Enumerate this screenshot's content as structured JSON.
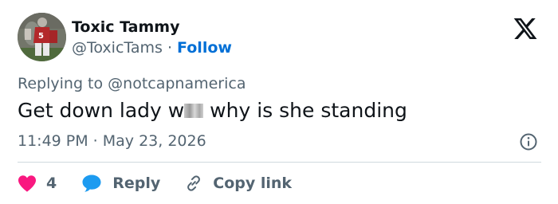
{
  "author": {
    "display_name": "Toxic Tammy",
    "handle": "@ToxicTams",
    "separator": "·",
    "follow_label": "Follow",
    "avatar_icon": "football-player-avatar"
  },
  "brand": {
    "logo_icon": "x-logo-icon"
  },
  "tweet": {
    "replying_to": "Replying to @notcapnamerica",
    "text_before": "Get down lady w",
    "text_after": " why is she standing",
    "timestamp": "11:49 PM · May 23, 2026"
  },
  "actions": {
    "like_count": "4",
    "reply_label": "Reply",
    "copy_link_label": "Copy link"
  },
  "colors": {
    "text_primary": "#0f1419",
    "text_secondary": "#536471",
    "link_blue": "#006fd6",
    "heart_pink": "#f91880",
    "reply_blue": "#1d9bf0",
    "divider": "#cfd9de"
  }
}
